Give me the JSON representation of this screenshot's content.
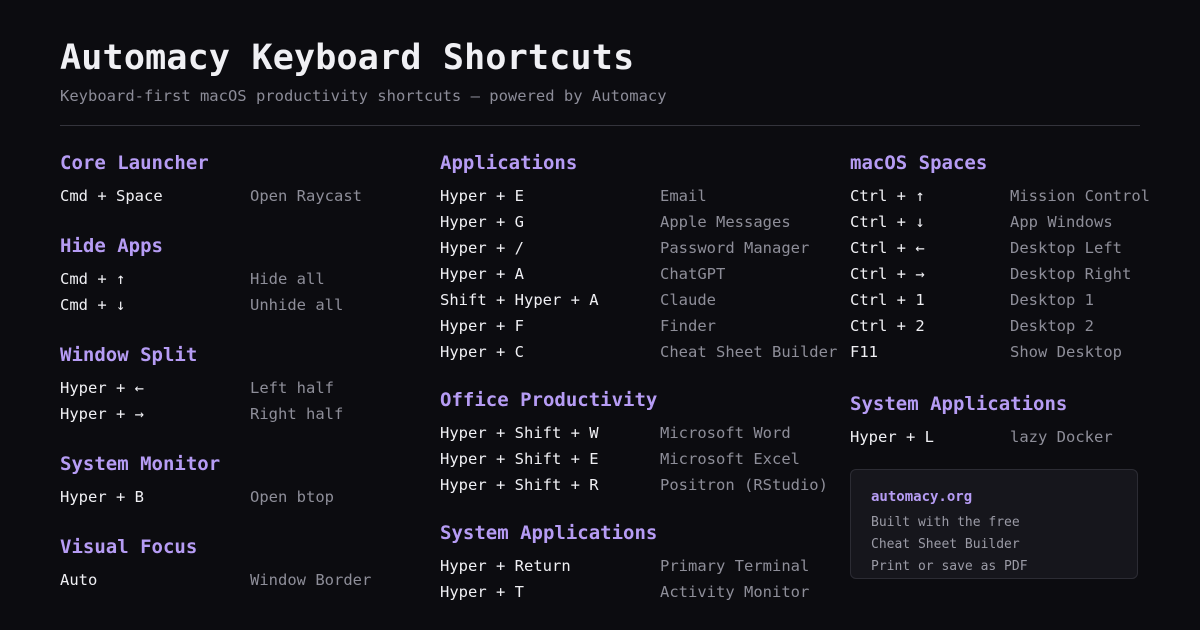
{
  "header": {
    "title": "Automacy Keyboard Shortcuts",
    "subtitle": "Keyboard-first macOS productivity shortcuts — powered by Automacy"
  },
  "columns": [
    {
      "sections": [
        {
          "title": "Core Launcher",
          "rows": [
            {
              "key": "Cmd + Space",
              "desc": "Open Raycast"
            }
          ]
        },
        {
          "title": "Hide Apps",
          "rows": [
            {
              "key": "Cmd + ↑",
              "desc": "Hide all"
            },
            {
              "key": "Cmd + ↓",
              "desc": "Unhide all"
            }
          ]
        },
        {
          "title": "Window Split",
          "rows": [
            {
              "key": "Hyper + ←",
              "desc": "Left half"
            },
            {
              "key": "Hyper + →",
              "desc": "Right half"
            }
          ]
        },
        {
          "title": "System Monitor",
          "rows": [
            {
              "key": "Hyper + B",
              "desc": "Open btop"
            }
          ]
        },
        {
          "title": "Visual Focus",
          "rows": [
            {
              "key": "Auto",
              "desc": "Window Border"
            }
          ]
        }
      ]
    },
    {
      "sections": [
        {
          "title": "Applications",
          "rows": [
            {
              "key": "Hyper + E",
              "desc": "Email"
            },
            {
              "key": "Hyper + G",
              "desc": "Apple Messages"
            },
            {
              "key": "Hyper + /",
              "desc": "Password Manager"
            },
            {
              "key": "Hyper + A",
              "desc": "ChatGPT"
            },
            {
              "key": "Shift + Hyper + A",
              "desc": "Claude"
            },
            {
              "key": "Hyper + F",
              "desc": "Finder"
            },
            {
              "key": "Hyper + C",
              "desc": "Cheat Sheet Builder"
            }
          ]
        },
        {
          "title": "Office Productivity",
          "rows": [
            {
              "key": "Hyper + Shift + W",
              "desc": "Microsoft Word"
            },
            {
              "key": "Hyper + Shift + E",
              "desc": "Microsoft Excel"
            },
            {
              "key": "Hyper + Shift + R",
              "desc": "Positron (RStudio)"
            }
          ]
        },
        {
          "title": "System Applications",
          "rows": [
            {
              "key": "Hyper + Return",
              "desc": "Primary Terminal"
            },
            {
              "key": "Hyper + T",
              "desc": "Activity Monitor"
            }
          ]
        }
      ]
    },
    {
      "sections": [
        {
          "title": "macOS Spaces",
          "rows": [
            {
              "key": "Ctrl + ↑",
              "desc": "Mission Control"
            },
            {
              "key": "Ctrl + ↓",
              "desc": "App Windows"
            },
            {
              "key": "Ctrl + ←",
              "desc": "Desktop Left"
            },
            {
              "key": "Ctrl + →",
              "desc": "Desktop Right"
            },
            {
              "key": "Ctrl + 1",
              "desc": "Desktop 1"
            },
            {
              "key": "Ctrl + 2",
              "desc": "Desktop 2"
            },
            {
              "key": "F11",
              "desc": "Show Desktop"
            }
          ]
        },
        {
          "title": "System Applications",
          "rows": [
            {
              "key": "Hyper + L",
              "desc": "lazy Docker"
            }
          ]
        }
      ]
    }
  ],
  "info_card": {
    "link": "automacy.org",
    "lines": [
      "Built with the free",
      "Cheat Sheet Builder",
      "Print or save as PDF"
    ]
  },
  "colors": {
    "background": "#0c0c10",
    "accent": "#b69cf4",
    "key_text": "#f0f0f4",
    "desc_text": "#8e8e99"
  }
}
